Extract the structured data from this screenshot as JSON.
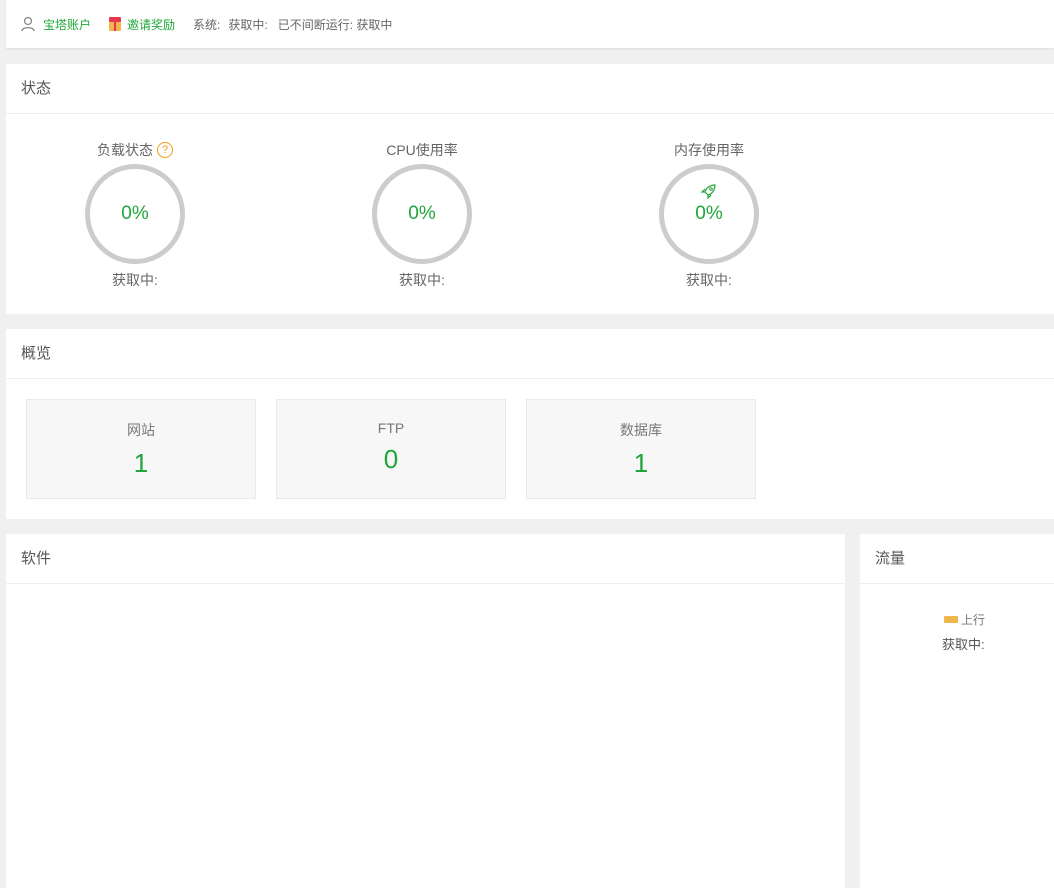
{
  "topbar": {
    "account_label": "宝塔账户",
    "invite_label": "邀请奖励",
    "system_label": "系统:",
    "system_value": "获取中:",
    "uptime_label": "已不间断运行: 获取中"
  },
  "status": {
    "title": "状态",
    "gauges": [
      {
        "label": "负载状态",
        "value": "0%",
        "sub": "获取中:"
      },
      {
        "label": "CPU使用率",
        "value": "0%",
        "sub": "获取中:"
      },
      {
        "label": "内存使用率",
        "value": "0%",
        "sub": "获取中:"
      }
    ]
  },
  "overview": {
    "title": "概览",
    "cards": [
      {
        "name": "网站",
        "value": "1"
      },
      {
        "name": "FTP",
        "value": "0"
      },
      {
        "name": "数据库",
        "value": "1"
      }
    ]
  },
  "software": {
    "title": "软件"
  },
  "traffic": {
    "title": "流量",
    "legend_up": "上行",
    "status": "获取中:"
  },
  "colors": {
    "accent": "#20a53a",
    "ring": "#cccccc",
    "legend_up": "#f0b54d",
    "help": "#f39c12"
  }
}
